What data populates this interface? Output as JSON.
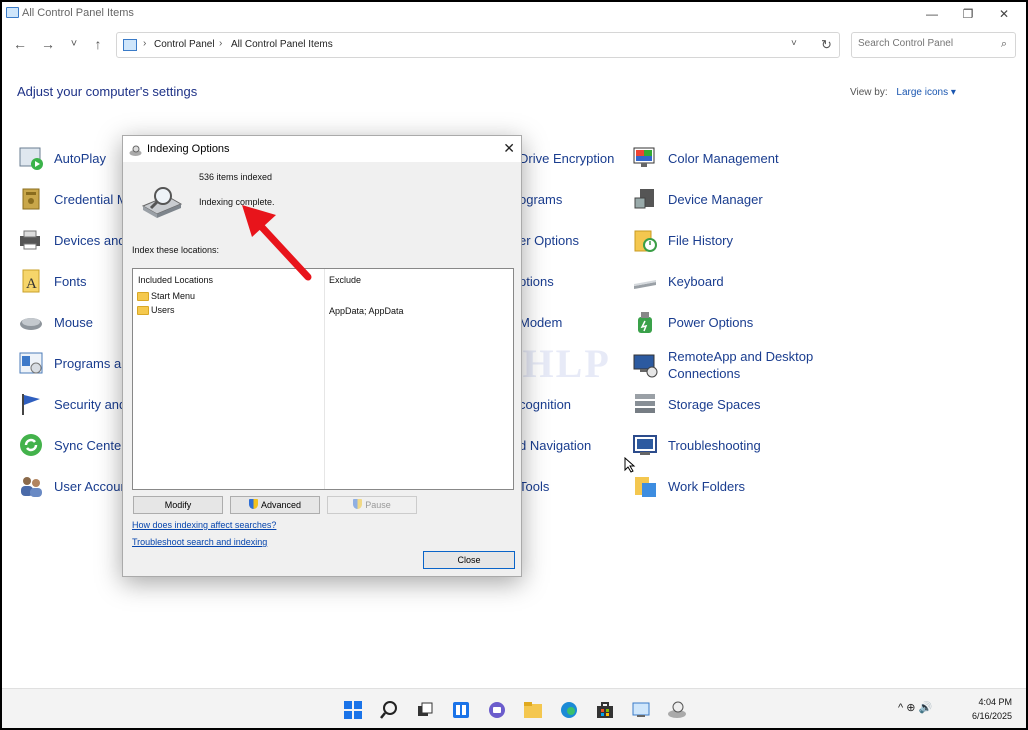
{
  "window": {
    "title": "All Control Panel Items"
  },
  "nav": {
    "back_icon": "←",
    "forward_icon": "→",
    "recent_icon": "˅",
    "up_icon": "↑",
    "breadcrumb": [
      "Control Panel",
      "All Control Panel Items"
    ],
    "separator": "›",
    "dropdown_icon": "˅",
    "refresh_icon": "↻",
    "search_placeholder": "Search Control Panel",
    "search_icon": "⌕"
  },
  "heading": "Adjust your computer's settings",
  "view_by": {
    "label": "View by:",
    "value": "Large icons ▾"
  },
  "items_col1": [
    "AutoPlay",
    "Credential M",
    "Devices and",
    "Fonts",
    "Mouse",
    "Programs ar",
    "Security and",
    "Sync Center",
    "User Accoun"
  ],
  "items_col3": [
    "Drive Encryption",
    "ograms",
    "er Options",
    "ptions",
    "Modem",
    "",
    "cognition",
    "d Navigation",
    "Tools"
  ],
  "items_col4": [
    "Color Management",
    "Device Manager",
    "File History",
    "Keyboard",
    "Power Options",
    "RemoteApp and Desktop Connections",
    "Storage Spaces",
    "Troubleshooting",
    "Work Folders"
  ],
  "watermark": "IT Pros HLP",
  "dialog": {
    "title": "Indexing Options",
    "close": "✕",
    "items_indexed": "536 items indexed",
    "status": "Indexing complete.",
    "index_label": "Index these locations:",
    "col_included": "Included Locations",
    "col_exclude": "Exclude",
    "locations": [
      "Start Menu",
      "Users"
    ],
    "exclude_value": "AppData; AppData",
    "btn_modify": "Modify",
    "btn_advanced": "Advanced",
    "btn_pause": "Pause",
    "link_affect": "How does indexing affect searches?",
    "link_troubleshoot": "Troubleshoot search and indexing",
    "btn_close": "Close"
  },
  "taskbar": {
    "tray_icons": "^  ⊕  🔊",
    "time": "4:04 PM",
    "date": "6/16/2025"
  },
  "colors": {
    "link": "#1a3d8f",
    "accent": "#0a64c8",
    "arrow": "#e8141b"
  }
}
